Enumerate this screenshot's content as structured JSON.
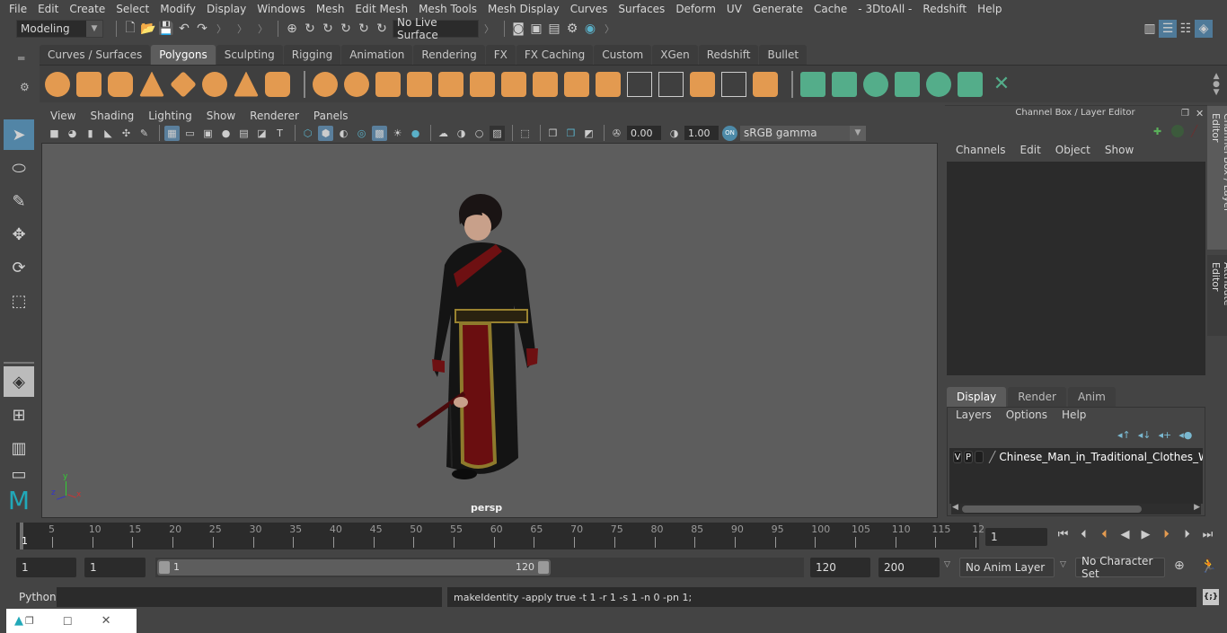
{
  "menubar": [
    "File",
    "Edit",
    "Create",
    "Select",
    "Modify",
    "Display",
    "Windows",
    "Mesh",
    "Edit Mesh",
    "Mesh Tools",
    "Mesh Display",
    "Curves",
    "Surfaces",
    "Deform",
    "UV",
    "Generate",
    "Cache",
    "- 3DtoAll -",
    "Redshift",
    "Help"
  ],
  "statusline": {
    "mode": "Modeling",
    "live_surface": "No Live Surface"
  },
  "shelf": {
    "tabs": [
      "Curves / Surfaces",
      "Polygons",
      "Sculpting",
      "Rigging",
      "Animation",
      "Rendering",
      "FX",
      "FX Caching",
      "Custom",
      "XGen",
      "Redshift",
      "Bullet"
    ],
    "active_tab": "Polygons"
  },
  "viewport": {
    "menu": [
      "View",
      "Shading",
      "Lighting",
      "Show",
      "Renderer",
      "Panels"
    ],
    "exposure": "0.00",
    "gamma": "1.00",
    "color_space": "sRGB gamma",
    "color_mgmt": "ON",
    "camera": "persp",
    "axis": {
      "x": "x",
      "y": "y",
      "z": "z"
    }
  },
  "channelbox": {
    "title": "Channel Box / Layer Editor",
    "menu": [
      "Channels",
      "Edit",
      "Object",
      "Show"
    ]
  },
  "layers": {
    "tabs": [
      "Display",
      "Render",
      "Anim"
    ],
    "active_tab": "Display",
    "menu": [
      "Layers",
      "Options",
      "Help"
    ],
    "items": [
      {
        "v": "V",
        "p": "P",
        "name": "Chinese_Man_in_Traditional_Clothes_Walki"
      }
    ]
  },
  "sidetabs": [
    "Channel Box / Layer Editor",
    "Attribute Editor"
  ],
  "timeline": {
    "ticks": [
      "5",
      "10",
      "15",
      "20",
      "25",
      "30",
      "35",
      "40",
      "45",
      "50",
      "55",
      "60",
      "65",
      "70",
      "75",
      "80",
      "85",
      "90",
      "95",
      "100",
      "105",
      "110",
      "115",
      "12"
    ],
    "start_label": "1",
    "current_frame": "1"
  },
  "range": {
    "start": "1",
    "current": "1",
    "bar_start": "1",
    "bar_end": "120",
    "end": "120",
    "max": "200",
    "anim_layer": "No Anim Layer",
    "character_set": "No Character Set"
  },
  "cmdline": {
    "lang": "Python",
    "output": "makeIdentity -apply true -t 1 -r 1 -s 1 -n 0 -pn 1;"
  }
}
